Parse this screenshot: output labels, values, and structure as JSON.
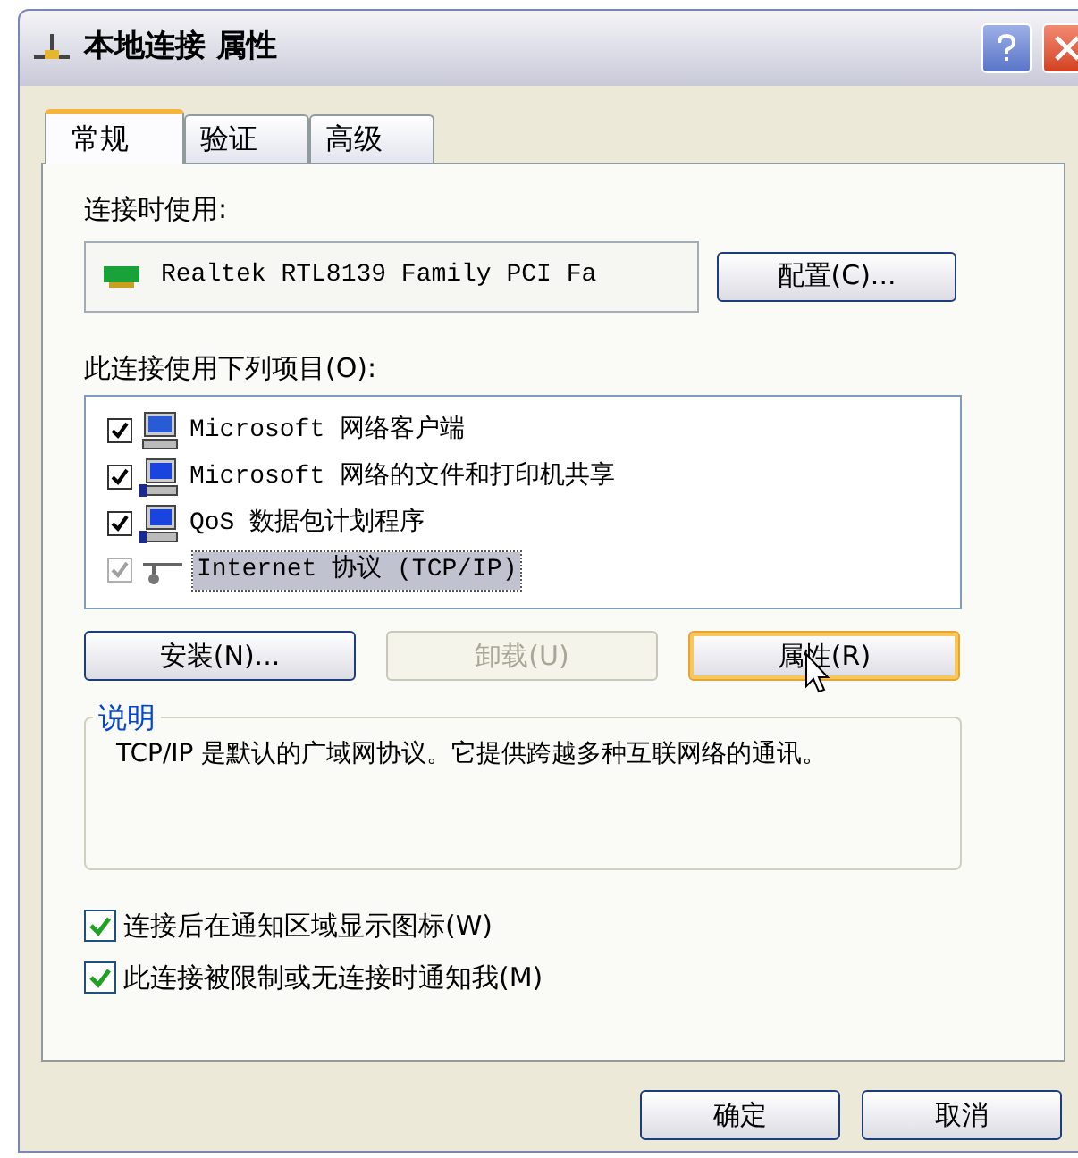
{
  "window": {
    "title": "本地连接 属性"
  },
  "tabs": [
    {
      "label": "常规",
      "selected": true
    },
    {
      "label": "验证",
      "selected": false
    },
    {
      "label": "高级",
      "selected": false
    }
  ],
  "adapter": {
    "label": "连接时使用:",
    "device": "Realtek RTL8139 Family PCI Fa",
    "configure_button": "配置(C)..."
  },
  "components": {
    "label": "此连接使用下列项目(O):",
    "items": [
      {
        "kind": "client",
        "label": "Microsoft 网络客户端",
        "checked": true,
        "disabled": false,
        "selected": false
      },
      {
        "kind": "service",
        "label": "Microsoft 网络的文件和打印机共享",
        "checked": true,
        "disabled": false,
        "selected": false
      },
      {
        "kind": "service",
        "label": "QoS 数据包计划程序",
        "checked": true,
        "disabled": false,
        "selected": false
      },
      {
        "kind": "protocol",
        "label": "Internet 协议 (TCP/IP)",
        "checked": true,
        "disabled": true,
        "selected": true
      }
    ]
  },
  "actions": [
    {
      "label": "安装(N)...",
      "disabled": false,
      "focused": false
    },
    {
      "label": "卸载(U)",
      "disabled": true,
      "focused": false
    },
    {
      "label": "属性(R)",
      "disabled": false,
      "focused": true
    }
  ],
  "description": {
    "title": "说明",
    "text": "TCP/IP 是默认的广域网协议。它提供跨越多种互联网络的通讯。"
  },
  "options": [
    {
      "label": "连接后在通知区域显示图标(W)",
      "checked": true
    },
    {
      "label": "此连接被限制或无连接时通知我(M)",
      "checked": true
    }
  ],
  "buttons": [
    "确定",
    "取消"
  ]
}
